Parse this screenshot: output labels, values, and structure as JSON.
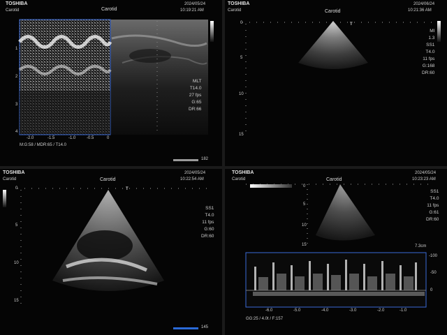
{
  "panels": [
    {
      "brand": "TOSHIBA",
      "probe": "Carotid",
      "date": "2024/05/24",
      "time": "10:19:21 AM",
      "sub": "Carotid",
      "params": [
        "MLT",
        "T14.0",
        "27 fps",
        "G:65",
        "DR:66"
      ],
      "depth_labels": [
        "1",
        "2",
        "3",
        "4"
      ],
      "mmode_time_labels": [
        "-2.0",
        "-1.5",
        "-1.0",
        "-0.5",
        "0"
      ],
      "bottom_text": "M:G:58 / MDR:65 / T14.0",
      "frame": "182"
    },
    {
      "brand": "TOSHIBA",
      "probe": "Carotid",
      "date": "2024/06/24",
      "time": "10:21:36 AM",
      "params": [
        "MI",
        "1.3",
        "SS1",
        "T4.0",
        "11 fps",
        "G:168",
        "DR:60"
      ],
      "depth_labels": [
        "0",
        "5",
        "10",
        "15"
      ]
    },
    {
      "brand": "TOSHIBA",
      "probe": "Carotid",
      "date": "2024/05/24",
      "time": "10:22:54 AM",
      "params": [
        "SS1",
        "T4.0",
        "11 fps",
        "G:60",
        "DR:60"
      ],
      "depth_labels": [
        "0",
        "5",
        "10",
        "15"
      ],
      "frame": "145"
    },
    {
      "brand": "TOSHIBA",
      "probe": "Carotid",
      "date": "2024/05/24",
      "time": "10:23:23 AM",
      "params": [
        "SS1",
        "T4.0",
        "11 fps",
        "G:61",
        "DR:60"
      ],
      "depth_labels": [
        "0",
        "5",
        "10",
        "15"
      ],
      "doppler_scale": [
        "-100",
        "-50",
        "0"
      ],
      "doppler_time": [
        "-6.0",
        "-5.0",
        "-4.0",
        "-3.0",
        "-2.0",
        "-1.0"
      ],
      "bottom_text": "GG:25 / 4.0t / F:157",
      "depth_readout": "7.3cm"
    }
  ]
}
